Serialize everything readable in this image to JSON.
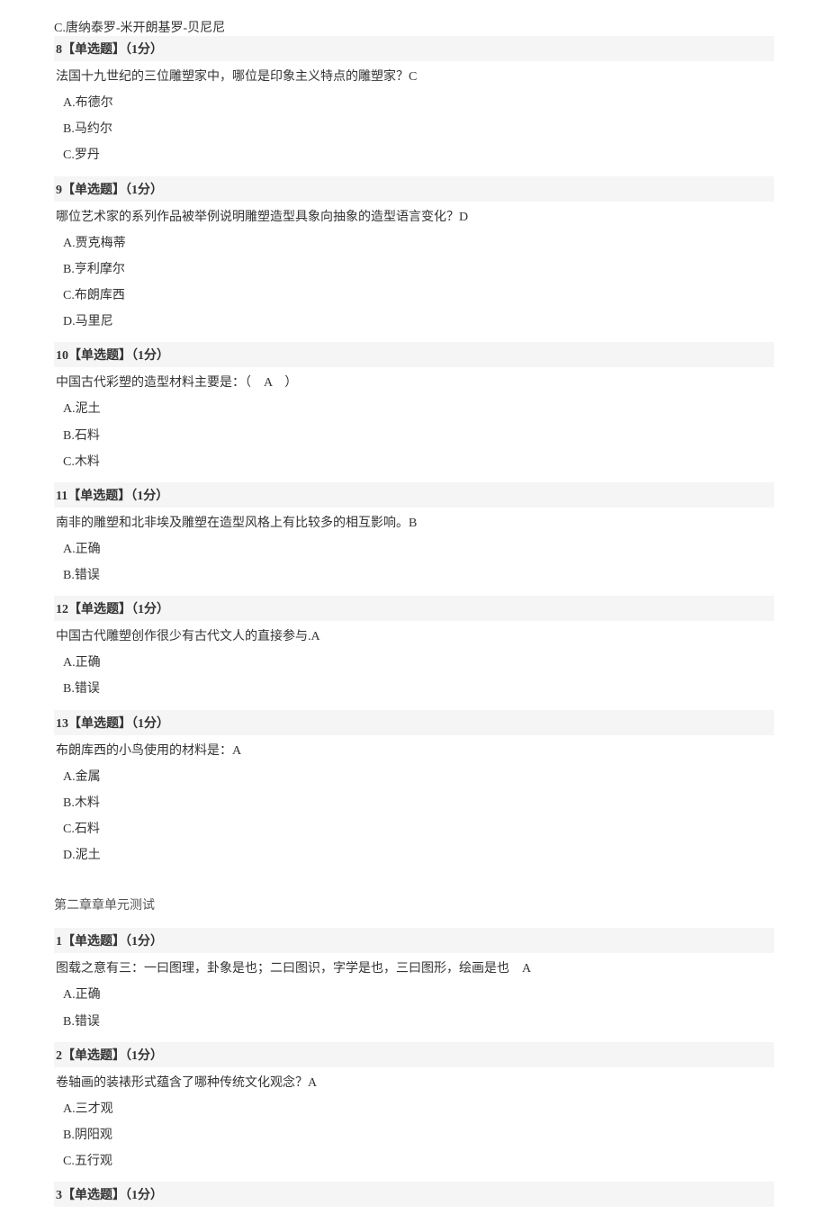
{
  "prev_answer": {
    "text": "C.唐纳泰罗-米开朗基罗-贝尼尼"
  },
  "questions": [
    {
      "id": "8",
      "type": "【单选题】（1分）",
      "text": "法国十九世纪的三位雕塑家中，哪位是印象主义特点的雕塑家？C",
      "options": [
        "A.布德尔",
        "B.马约尔",
        "C.罗丹"
      ],
      "correct": "C"
    },
    {
      "id": "9",
      "type": "【单选题】（1分）",
      "text": "哪位艺术家的系列作品被举例说明雕塑造型具象向抽象的造型语言变化？D",
      "options": [
        "A.贾克梅蒂",
        "B.亨利摩尔",
        "C.布朗库西",
        "D.马里尼"
      ],
      "correct": "D"
    },
    {
      "id": "10",
      "type": "【单选题】（1分）",
      "text": "中国古代彩塑的造型材料主要是：（　A　）",
      "options": [
        "A.泥土",
        "B.石料",
        "C.木料"
      ],
      "correct": "A"
    },
    {
      "id": "11",
      "type": "【单选题】（1分）",
      "text": "南非的雕塑和北非埃及雕塑在造型风格上有比较多的相互影响。B",
      "options": [
        "A.正确",
        "B.错误"
      ],
      "correct": "B"
    },
    {
      "id": "12",
      "type": "【单选题】（1分）",
      "text": "中国古代雕塑创作很少有古代文人的直接参与.A",
      "options": [
        "A.正确",
        "B.错误"
      ],
      "correct": "A"
    },
    {
      "id": "13",
      "type": "【单选题】（1分）",
      "text": "布朗库西的小鸟使用的材料是：A",
      "options": [
        "A.金属",
        "B.木料",
        "C.石料",
        "D.泥土"
      ],
      "correct": "A"
    }
  ],
  "section2": {
    "title": "第二章章单元测试",
    "questions": [
      {
        "id": "1",
        "type": "【单选题】（1分）",
        "text": "图载之意有三：一曰图理，卦象是也；二曰图识，字学是也，三曰图形，绘画是也　A",
        "options": [
          "A.正确",
          "B.错误"
        ],
        "correct": "A"
      },
      {
        "id": "2",
        "type": "【单选题】（1分）",
        "text": "卷轴画的装裱形式蕴含了哪种传统文化观念？A",
        "options": [
          "A.三才观",
          "B.阴阳观",
          "C.五行观"
        ],
        "correct": "A"
      },
      {
        "id": "3",
        "type": "【单选题】（1分）",
        "text": "",
        "options": [],
        "correct": ""
      }
    ]
  }
}
